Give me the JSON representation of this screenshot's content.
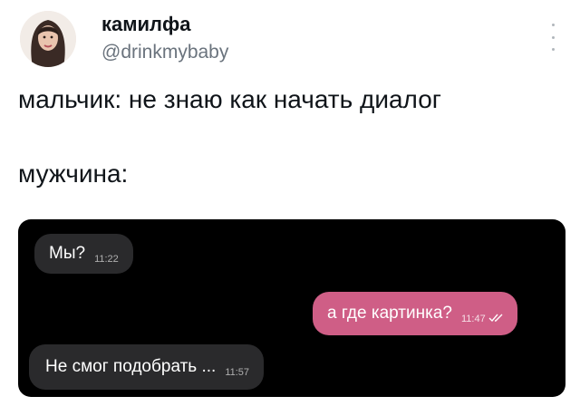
{
  "author": {
    "display_name": "камилфа",
    "handle": "@drinkmybaby"
  },
  "tweet": {
    "lines": [
      "мальчик: не знаю как начать диалог",
      "мужчина:"
    ]
  },
  "chat": {
    "messages": [
      {
        "direction": "incoming",
        "text": "Мы?",
        "time": "11:22"
      },
      {
        "direction": "outgoing",
        "text": "а где картинка?",
        "time": "11:47",
        "status": "read"
      },
      {
        "direction": "incoming",
        "text": "Не смог подобрать ...",
        "time": "11:57"
      }
    ]
  },
  "colors": {
    "incoming_bubble": "#2a2a2c",
    "outgoing_bubble": "#cf5e86",
    "chat_background": "#000000"
  },
  "icons": {
    "more": "vertical-dots-icon",
    "read_receipt": "double-check-icon"
  }
}
